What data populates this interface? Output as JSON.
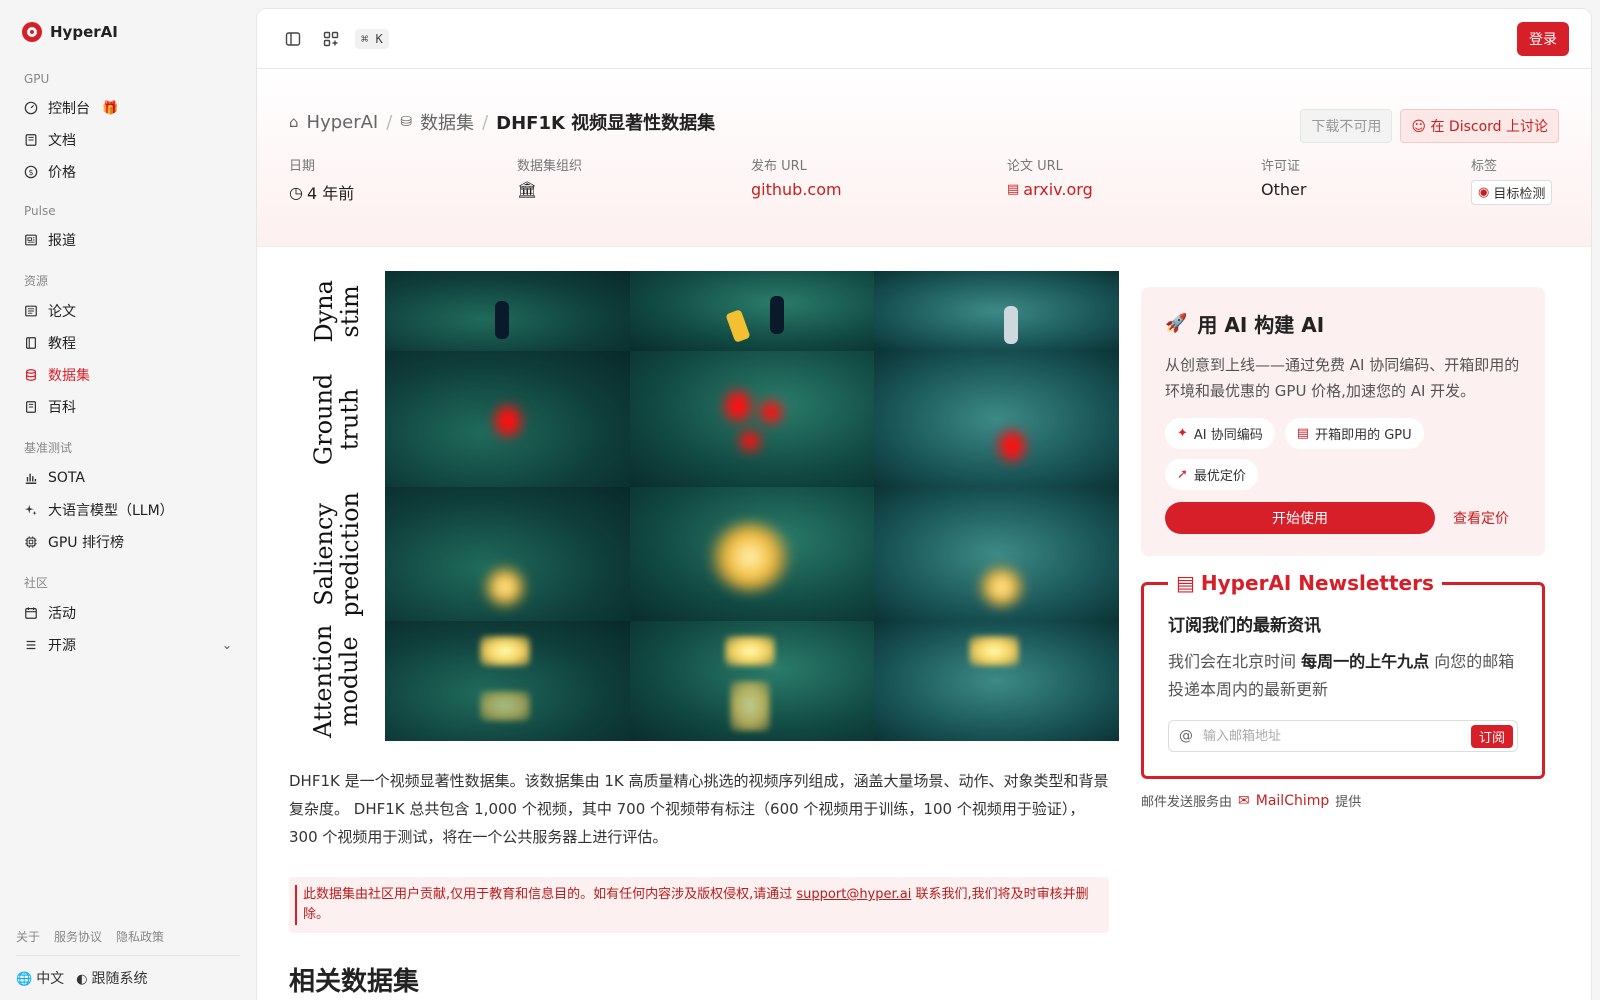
{
  "brand": {
    "name": "HyperAI"
  },
  "sidebar": {
    "sections": [
      {
        "label": "GPU",
        "items": [
          {
            "label": "控制台",
            "icon": "gauge-icon"
          },
          {
            "label": "文档",
            "icon": "book-icon"
          },
          {
            "label": "价格",
            "icon": "dollar-icon"
          }
        ]
      },
      {
        "label": "Pulse",
        "items": [
          {
            "label": "报道",
            "icon": "newspaper-icon"
          }
        ]
      },
      {
        "label": "资源",
        "items": [
          {
            "label": "论文",
            "icon": "paper-icon"
          },
          {
            "label": "教程",
            "icon": "tutorial-icon"
          },
          {
            "label": "数据集",
            "icon": "database-icon",
            "active": true
          },
          {
            "label": "百科",
            "icon": "encyclopedia-icon"
          }
        ]
      },
      {
        "label": "基准测试",
        "items": [
          {
            "label": "SOTA",
            "icon": "bar-chart-icon"
          },
          {
            "label": "大语言模型（LLM）",
            "icon": "sparkles-icon"
          },
          {
            "label": "GPU 排行榜",
            "icon": "chip-icon"
          }
        ]
      },
      {
        "label": "社区",
        "items": [
          {
            "label": "活动",
            "icon": "calendar-icon"
          },
          {
            "label": "开源",
            "icon": "list-icon"
          }
        ]
      }
    ],
    "footer_links": [
      "关于",
      "服务协议",
      "隐私政策"
    ],
    "language": "中文",
    "theme": "跟随系统"
  },
  "topbar": {
    "shortcut": "⌘ K",
    "login_label": "登录"
  },
  "breadcrumb": {
    "home": "HyperAI",
    "section": "数据集",
    "current": "DHF1K 视频显著性数据集"
  },
  "actions": {
    "download_label": "下载不可用",
    "discord_label": "在 Discord 上讨论"
  },
  "meta": {
    "date_label": "日期",
    "date_value": "4 年前",
    "org_label": "数据集组织",
    "release_url_label": "发布 URL",
    "release_url_value": "github.com",
    "paper_url_label": "论文 URL",
    "paper_url_value": "arxiv.org",
    "license_label": "许可证",
    "license_value": "Other",
    "tags_label": "标签",
    "tag_value": "目标检测"
  },
  "figure": {
    "row_labels": [
      [
        "Dyna",
        "stim"
      ],
      [
        "Ground",
        "truth"
      ],
      [
        "Saliency",
        "prediction"
      ],
      [
        "Attention",
        "module"
      ]
    ]
  },
  "description": "DHF1K 是一个视频显著性数据集。该数据集由 1K 高质量精心挑选的视频序列组成，涵盖大量场景、动作、对象类型和背景复杂度。 DHF1K 总共包含 1,000 个视频，其中 700 个视频带有标注（600 个视频用于训练，100 个视频用于验证），300 个视频用于测试，将在一个公共服务器上进行评估。",
  "notice": {
    "before": "此数据集由社区用户贡献,仅用于教育和信息目的。如有任何内容涉及版权侵权,请通过 ",
    "email": "support@hyper.ai",
    "after": " 联系我们,我们将及时审核并删除。"
  },
  "related_title": "相关数据集",
  "promo": {
    "title": "用 AI 构建 AI",
    "desc": "从创意到上线——通过免费 AI 协同编码、开箱即用的环境和最优惠的 GPU 价格,加速您的 AI 开发。",
    "chips": [
      "AI 协同编码",
      "开箱即用的 GPU",
      "最优定价"
    ],
    "start_label": "开始使用",
    "pricing_label": "查看定价"
  },
  "newsletter": {
    "title": "HyperAI Newsletters",
    "heading": "订阅我们的最新资讯",
    "text_before": "我们会在北京时间 ",
    "text_bold": "每周一的上午九点",
    "text_after": " 向您的邮箱投递本周内的最新更新",
    "placeholder": "输入邮箱地址",
    "subscribe_label": "订阅",
    "mail_prefix": "邮件发送服务由",
    "mail_brand": "MailChimp",
    "mail_suffix": "提供"
  },
  "colors": {
    "accent": "#d71f2a",
    "promo_bg": "#fdf0f0"
  }
}
